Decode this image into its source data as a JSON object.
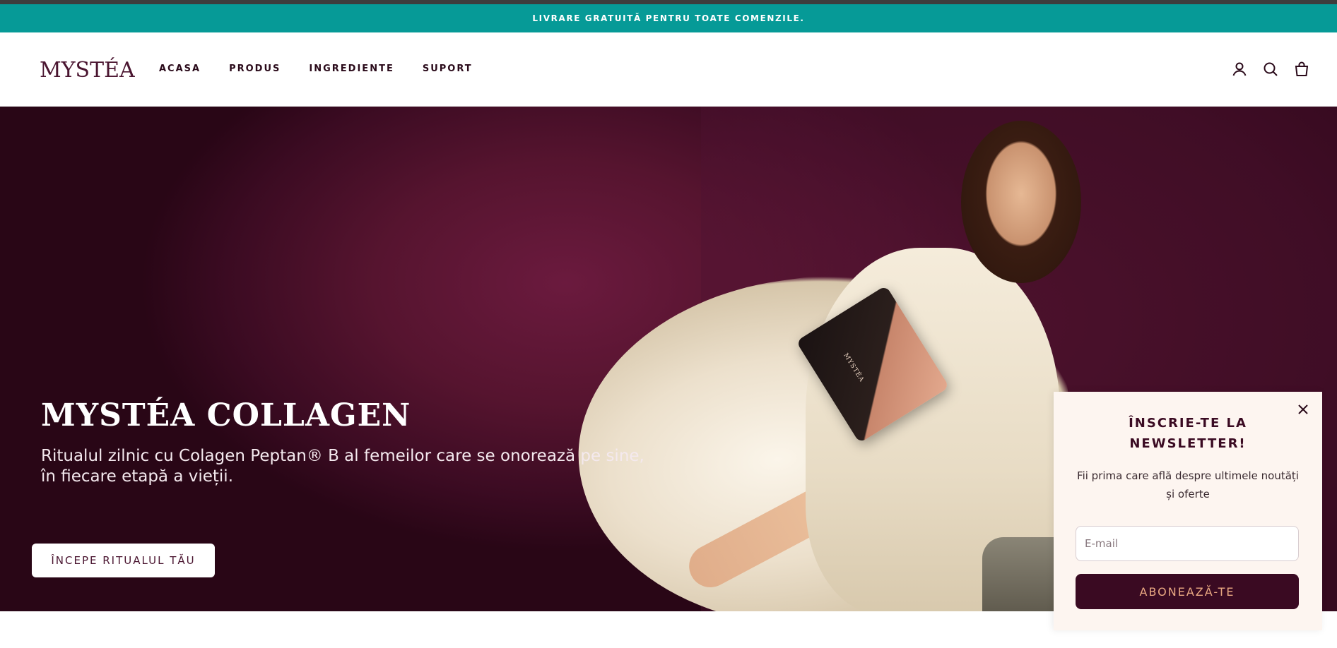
{
  "announcement": {
    "text": "LIVRARE GRATUITĂ PENTRU TOATE COMENZILE."
  },
  "header": {
    "logo": "MYSTÉA",
    "menu": [
      {
        "label": "ACASA"
      },
      {
        "label": "PRODUS"
      },
      {
        "label": "INGREDIENTE"
      },
      {
        "label": "SUPORT"
      }
    ],
    "icons": [
      "account-icon",
      "search-icon",
      "cart-icon"
    ]
  },
  "hero": {
    "title": "MYSTÉA COLLAGEN",
    "subtitle": "Ritualul zilnic cu Colagen Peptan® B al femeilor care se onorează pe sine, în fiecare etapă a vieții.",
    "cta": "ÎNCEPE RITUALUL TĂU",
    "product_label": "MYSTÉA"
  },
  "popup": {
    "title_line1": "ÎNSCRIE-TE LA",
    "title_line2": "NEWSLETTER!",
    "text": "Fii prima care află despre ultimele noutăți și oferte",
    "email_placeholder": "E-mail",
    "button": "ABONEAZĂ-TE",
    "close_icon": "close-icon"
  },
  "colors": {
    "announcement_bg": "#069a97",
    "brand": "#4a1530",
    "hero_bg": "#56142f",
    "popup_bg": "#fdf5f0",
    "popup_button_bg": "#3a0a22",
    "popup_button_text": "#e9a882"
  }
}
